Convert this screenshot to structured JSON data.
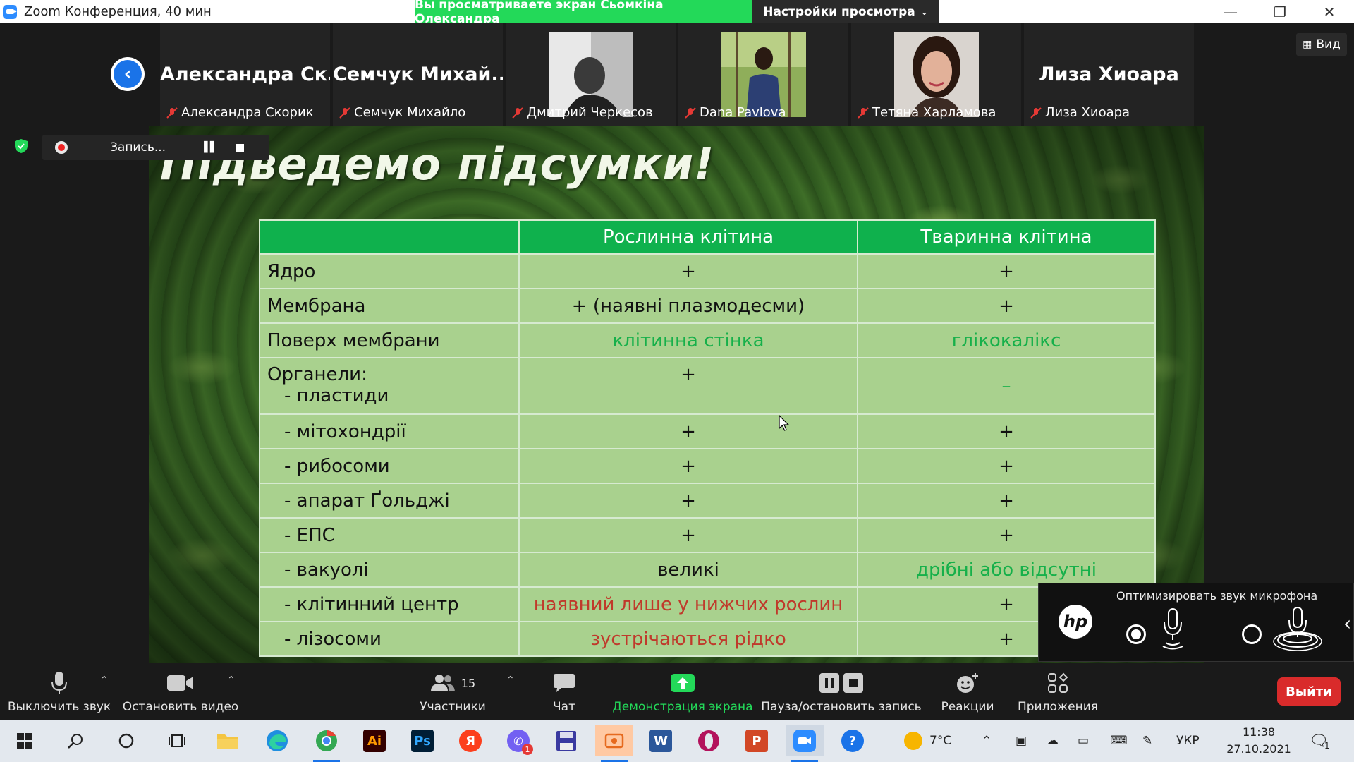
{
  "window": {
    "title": "Zoom Конференция, 40 мин",
    "share_banner": "Вы просматриваете экран Сьомкіна Олександра",
    "view_settings": "Настройки просмотра",
    "minimize": "—",
    "restore": "❐",
    "close": "✕"
  },
  "participants": [
    {
      "big_name": "Александра Ск...",
      "label": "Александра Скорик",
      "has_photo": false
    },
    {
      "big_name": "Семчук Михай...",
      "label": "Семчук Михайло",
      "has_photo": false
    },
    {
      "big_name": "",
      "label": "Дмитрий Черкесов",
      "has_photo": true
    },
    {
      "big_name": "",
      "label": "Dana Pavlova",
      "has_photo": true
    },
    {
      "big_name": "",
      "label": "Тетяна Харламова",
      "has_photo": true
    },
    {
      "big_name": "Лиза Хиоара",
      "label": "Лиза Хиоара",
      "has_photo": false
    }
  ],
  "view_button": "Вид",
  "recording": {
    "label": "Запись..."
  },
  "slide": {
    "title": "Підведемо підсумки!",
    "headers": [
      "",
      "Рослинна клітина",
      "Тваринна клітина"
    ],
    "rows": [
      {
        "c1": "Ядро",
        "c2": "+",
        "c3": "+"
      },
      {
        "c1": "Мембрана",
        "c2": "+ (наявні плазмодесми)",
        "c3": "+"
      },
      {
        "c1": "Поверх мембрани",
        "c2": "клітинна стінка",
        "c3": "глікокалікс"
      },
      {
        "c1a": "Органели:",
        "c1b": "- пластиди",
        "c2": "+",
        "c3": "–"
      },
      {
        "c1": "- мітохондрії",
        "c2": "+",
        "c3": "+"
      },
      {
        "c1": "- рибосоми",
        "c2": "+",
        "c3": "+"
      },
      {
        "c1": "- апарат Ґольджі",
        "c2": "+",
        "c3": "+"
      },
      {
        "c1": "- ЕПС",
        "c2": "+",
        "c3": "+"
      },
      {
        "c1": "- вакуолі",
        "c2": "великі",
        "c3": "дрібні або відсутні"
      },
      {
        "c1": "- клітинний центр",
        "c2": "наявний лише у нижчих рослин",
        "c3": "+"
      },
      {
        "c1": "- лізосоми",
        "c2": "зустрічаються рідко",
        "c3": "+"
      }
    ]
  },
  "hp_panel": {
    "title": "Оптимизировать звук микрофона",
    "logo": "hp"
  },
  "toolbar": {
    "mute": "Выключить звук",
    "video": "Остановить видео",
    "participants": "Участники",
    "participants_count": "15",
    "chat": "Чат",
    "share": "Демонстрация экрана",
    "record": "Пауза/остановить запись",
    "reactions": "Реакции",
    "apps": "Приложения",
    "leave": "Выйти"
  },
  "taskbar": {
    "weather": "7°C",
    "lang": "УКР",
    "time": "11:38",
    "date": "27.10.2021",
    "notification_count": "1",
    "viber_badge": "1"
  },
  "colors": {
    "zoom_blue": "#2d8cff",
    "share_green": "#23d959",
    "table_header": "#0fb14d",
    "table_cell": "#a9d18e",
    "leave_red": "#d92b2b"
  }
}
